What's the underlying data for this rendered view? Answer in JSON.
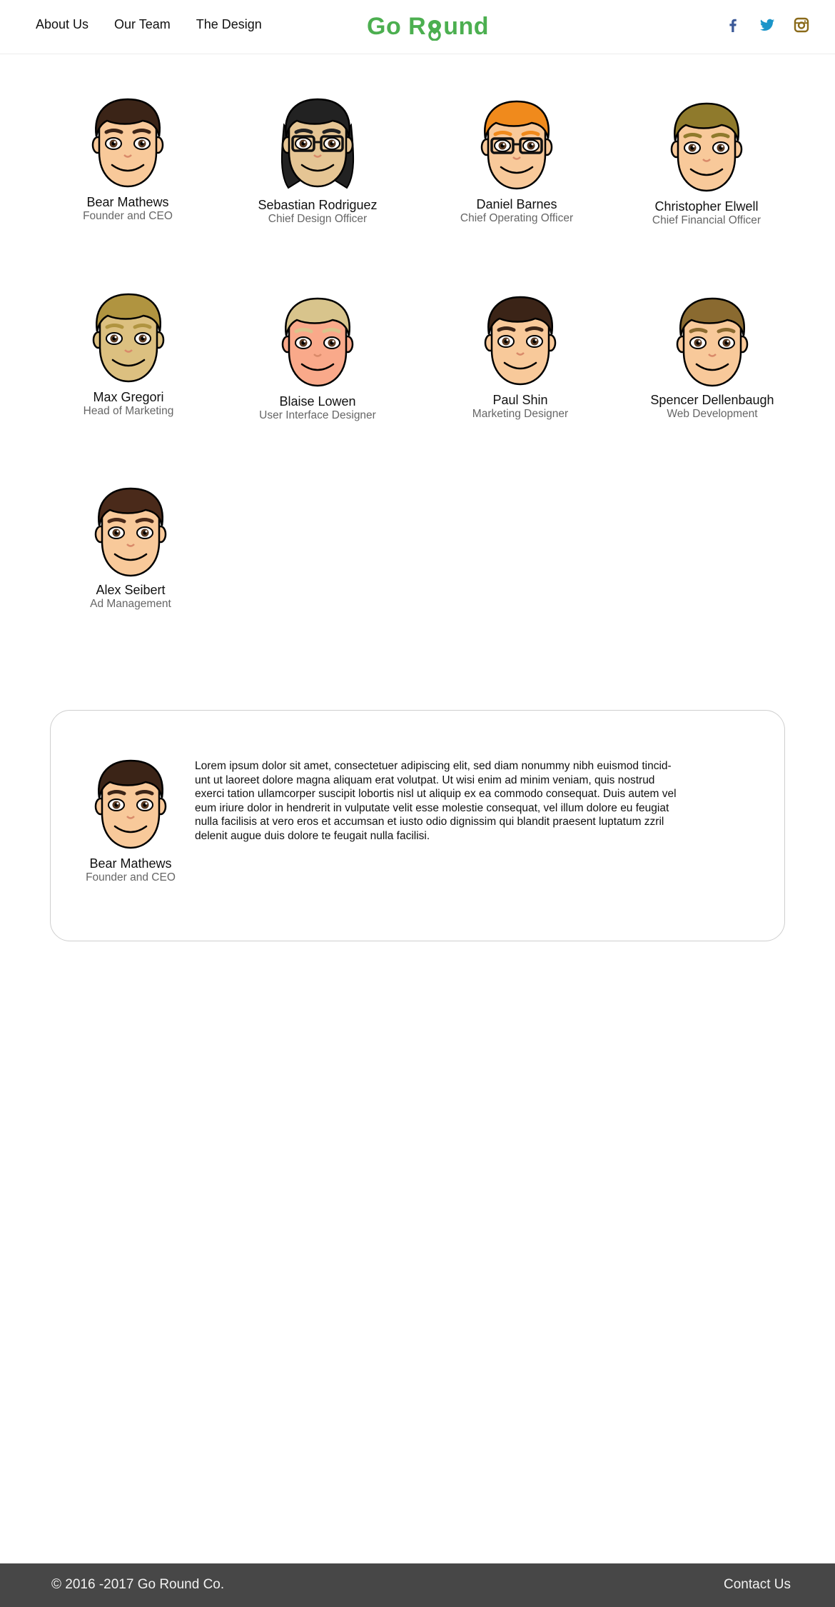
{
  "header": {
    "nav": [
      "About Us",
      "Our Team",
      "The Design"
    ],
    "logo": {
      "part1": "Go R",
      "part2": "und"
    },
    "socials": [
      {
        "icon": "facebook-icon",
        "color": "#3b5998"
      },
      {
        "icon": "twitter-icon",
        "color": "#1b95c9"
      },
      {
        "icon": "instagram-icon",
        "color": "#8a6a1a"
      }
    ]
  },
  "team": [
    {
      "name": "Bear Mathews",
      "role": "Founder and CEO",
      "hair": "#3b2417",
      "skin": "#f8c99a"
    },
    {
      "name": "Sebastian Rodriguez",
      "role": "Chief Design Officer",
      "hair": "#222222",
      "skin": "#e5c594",
      "glasses": true,
      "long": true
    },
    {
      "name": "Daniel Barnes",
      "role": "Chief Operating Officer",
      "hair": "#f08a1c",
      "skin": "#f8c99a",
      "glasses": true
    },
    {
      "name": "Christopher Elwell",
      "role": "Chief Financial Officer",
      "hair": "#8f7a2c",
      "skin": "#f8c99a"
    },
    {
      "name": "Max Gregori",
      "role": "Head of Marketing",
      "hair": "#b09440",
      "skin": "#dcc080"
    },
    {
      "name": "Blaise Lowen",
      "role": "User Interface Designer",
      "hair": "#d8c48c",
      "skin": "#f9a98a"
    },
    {
      "name": "Paul Shin",
      "role": "Marketing Designer",
      "hair": "#3b2417",
      "skin": "#f8c99a"
    },
    {
      "name": "Spencer Dellenbaugh",
      "role": "Web Development",
      "hair": "#8a6a30",
      "skin": "#f8c99a"
    },
    {
      "name": "Alex Seibert",
      "role": "Ad Management",
      "hair": "#4a2a1a",
      "skin": "#f8c99a"
    }
  ],
  "detail": {
    "name": "Bear Mathews",
    "role": "Founder and CEO",
    "hair": "#3b2417",
    "skin": "#f8c99a",
    "bio_lines": [
      "Lorem ipsum dolor sit amet, consectetuer adipiscing elit, sed diam nonummy nibh euismod tincid-",
      "unt ut laoreet dolore magna aliquam erat volutpat. Ut wisi enim ad minim veniam, quis nostrud",
      "exerci tation ullamcorper suscipit lobortis nisl ut aliquip ex ea commodo consequat. Duis autem vel",
      "eum iriure dolor in hendrerit in vulputate velit esse molestie consequat, vel illum dolore eu feugiat",
      "nulla facilisis at vero eros et accumsan et iusto odio dignissim qui blandit praesent luptatum zzril",
      "delenit augue duis dolore te feugait nulla facilisi."
    ]
  },
  "footer": {
    "copyright": "© 2016 -2017 Go Round Co.",
    "contact": "Contact Us"
  }
}
